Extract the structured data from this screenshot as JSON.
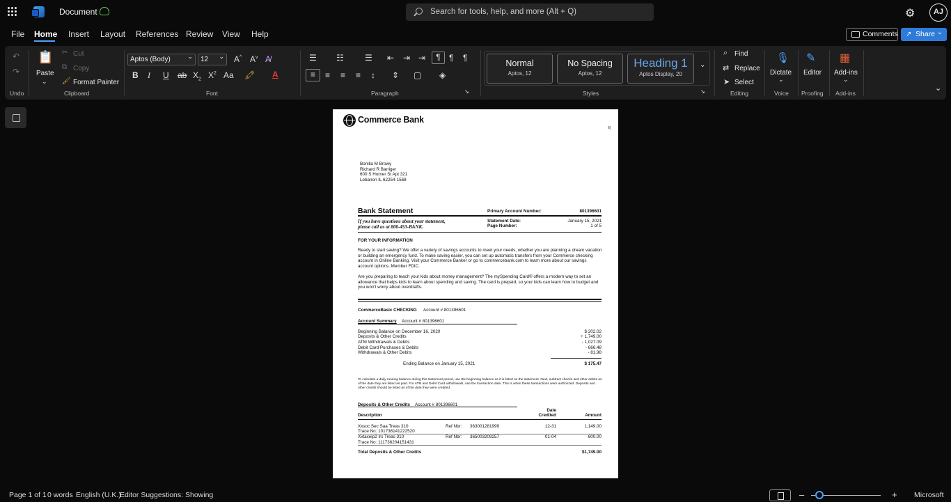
{
  "titlebar": {
    "app_icon": "word-icon",
    "doc_title": "Document",
    "sync_icon": "cloud-saved-icon",
    "search_placeholder": "Search for tools, help, and more (Alt + Q)",
    "settings_icon": "gear-icon",
    "avatar_initials": "AJ"
  },
  "menu": {
    "items": [
      "File",
      "Home",
      "Insert",
      "Layout",
      "References",
      "Review",
      "View",
      "Help"
    ],
    "active": "Home",
    "comments": "Comments",
    "share": "Share"
  },
  "ribbon": {
    "undo_group": "Undo",
    "clipboard": {
      "paste": "Paste",
      "cut": "Cut",
      "copy": "Copy",
      "format_painter": "Format Painter",
      "label": "Clipboard"
    },
    "font": {
      "name": "Aptos (Body)",
      "size": "12",
      "label": "Font"
    },
    "paragraph": {
      "label": "Paragraph"
    },
    "styles": {
      "label": "Styles",
      "items": [
        {
          "name": "Normal",
          "sub": "Aptos, 12"
        },
        {
          "name": "No Spacing",
          "sub": "Aptos, 12"
        },
        {
          "name": "Heading 1",
          "sub": "Aptos Display, 20"
        }
      ]
    },
    "editing": {
      "find": "Find",
      "replace": "Replace",
      "select": "Select",
      "label": "Editing"
    },
    "voice": {
      "dictate": "Dictate",
      "label": "Voice"
    },
    "proofing": {
      "editor": "Editor",
      "label": "Proofing"
    },
    "addins": {
      "addins": "Add-ins",
      "label": "Add-ins"
    },
    "accent_color": "#4aa3ff"
  },
  "document": {
    "logo_text": "Commerce Bank",
    "side_mark": "6|",
    "address": [
      "Bonilla M Browy",
      "Richard R Barriger",
      "600 S Horner St Apt 321",
      "Lebanon IL 62254-1568"
    ],
    "heading": "Bank Statement",
    "primary_account_label": "Primary Account Number:",
    "primary_account_number": "801396601",
    "questions_line1": "If you have questions about your statement,",
    "questions_line2": "please call us at 800-453-BANK.",
    "statement_date_label": "Statement Date:",
    "statement_date": "January  15, 2021",
    "page_number_label": "Page Number:",
    "page_number": "1 of 5",
    "info_heading": "FOR YOUR INFORMATION",
    "info_p1": "Ready to start saving?  We offer a variety of savings accounts to meet your needs, whether you are planning a dream vacation or building an emergency fund.  To make saving easier, you can set up automatic transfers from your Commerce checking account in Online Banking.  Visit your Commerce Banker or go to commercebank.com to learn more about our savings account options. Member FDIC.",
    "info_p2": "Are you preparing to teach your kids about money management? The mySpending Card® offers a modern way to set an allowance that helps kids to learn about spending and saving.  The card is prepaid, so your kids can learn how to budget and you won't worry about overdrafts.",
    "checking_title": "CommerceBasic CHECKING",
    "checking_account": "Account # 801396601",
    "summary_title": "Account Summary",
    "summary_account": "Account # 801396601",
    "summary_rows": [
      {
        "label": "Beginning Balance on  December 16, 2020",
        "value": "$ 202.02"
      },
      {
        "label": "Deposits & Other Credits",
        "value": "+ 1,749.00"
      },
      {
        "label": "ATM Withdrawals & Debits",
        "value": "- 1,027.09"
      },
      {
        "label": "Debit Card Purchases & Debits",
        "value": "- 666.48"
      },
      {
        "label": "Withdrawals & Other Debits",
        "value": "- 81.98"
      }
    ],
    "ending_label": "Ending Balance on January 15, 2021",
    "ending_value": "$ 175.47",
    "fine_print": "To calculate a daily running balance during this statement period, use the beginning balance as it is listed on the statement. Next, subtract checks and other debits as of the date they are listed as paid.  For ATM and Debit Card withdrawals, use the transaction date.  This is when these transactions were authorized.  Deposits and other credits should be listed as of the date they were credited.",
    "deposits_title": "Deposits & Other Credits",
    "deposits_account": "Account # 801396601",
    "col_description": "Description",
    "col_date_1": "Date",
    "col_date_2": "Credited",
    "col_amount": "Amount",
    "deposits": [
      {
        "desc": "Xxsoc Sec  Saa  Treas 310",
        "trace": "Trace No: 101736141222520",
        "ref_label": "Ref Nbr:",
        "ref": "363001281999",
        "date": "12-31",
        "amount": "1,149.00"
      },
      {
        "desc": "Xxtaxeip2  Irs  Treas 310",
        "trace": "Trace No: 111736204151431",
        "ref_label": "Ref Nbr:",
        "ref": "365003209257",
        "date": "01-04",
        "amount": "600.00"
      }
    ],
    "total_label": "Total Deposits & Other Credits",
    "total_value": "$1,749.00"
  },
  "status": {
    "page": "Page 1 of 1",
    "words": "0 words",
    "language": "English (U.K.)",
    "editor": "Editor Suggestions: Showing",
    "zoom_out": "–",
    "zoom_in": "+",
    "zoom_level_fraction": 0.12,
    "brand": "Microsoft"
  }
}
